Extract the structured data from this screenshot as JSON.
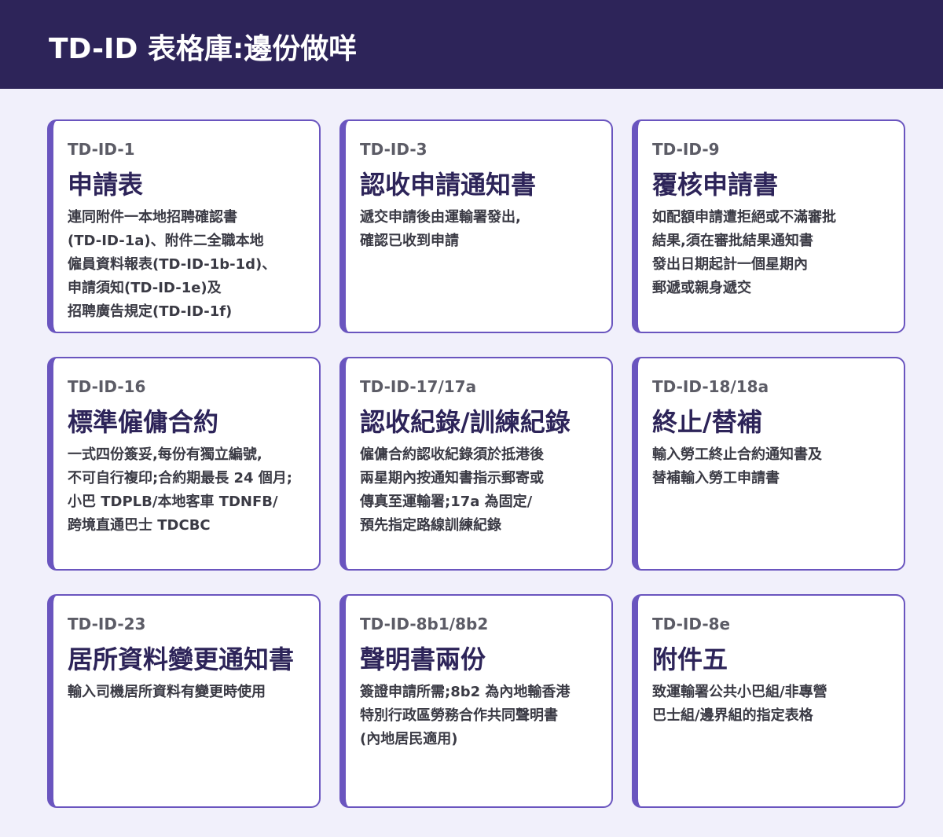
{
  "header": {
    "title": "TD-ID 表格庫:邊份做咩"
  },
  "colors": {
    "header_bg": "#2d2459",
    "page_bg": "#f1f0fb",
    "accent": "#6a55bf",
    "title_text": "#2d2459"
  },
  "cards": [
    {
      "code": "TD-ID-1",
      "title": "申請表",
      "lines": [
        "連同附件一本地招聘確認書",
        "(TD-ID-1a)、附件二全職本地",
        "僱員資料報表(TD-ID-1b-1d)、",
        "申請須知(TD-ID-1e)及",
        "招聘廣告規定(TD-ID-1f)"
      ]
    },
    {
      "code": "TD-ID-3",
      "title": "認收申請通知書",
      "lines": [
        "遞交申請後由運輸署發出,",
        "確認已收到申請"
      ]
    },
    {
      "code": "TD-ID-9",
      "title": "覆核申請書",
      "lines": [
        "如配額申請遭拒絕或不滿審批",
        "結果,須在審批結果通知書",
        "發出日期起計一個星期內",
        "郵遞或親身遞交"
      ]
    },
    {
      "code": "TD-ID-16",
      "title": "標準僱傭合約",
      "lines": [
        "一式四份簽妥,每份有獨立編號,",
        "不可自行複印;合約期最長 24 個月;",
        "小巴 TDPLB/本地客車 TDNFB/",
        "跨境直通巴士 TDCBC"
      ]
    },
    {
      "code": "TD-ID-17/17a",
      "title": "認收紀錄/訓練紀錄",
      "lines": [
        "僱傭合約認收紀錄須於抵港後",
        "兩星期內按通知書指示郵寄或",
        "傳真至運輸署;17a 為固定/",
        "預先指定路線訓練紀錄"
      ]
    },
    {
      "code": "TD-ID-18/18a",
      "title": "終止/替補",
      "lines": [
        "輸入勞工終止合約通知書及",
        "替補輸入勞工申請書"
      ]
    },
    {
      "code": "TD-ID-23",
      "title": "居所資料變更通知書",
      "lines": [
        "輸入司機居所資料有變更時使用"
      ]
    },
    {
      "code": "TD-ID-8b1/8b2",
      "title": "聲明書兩份",
      "lines": [
        "簽證申請所需;8b2 為內地輸香港",
        "特別行政區勞務合作共同聲明書",
        "(內地居民適用)"
      ]
    },
    {
      "code": "TD-ID-8e",
      "title": "附件五",
      "lines": [
        "致運輸署公共小巴組/非專營",
        "巴士組/邊界組的指定表格"
      ]
    }
  ]
}
